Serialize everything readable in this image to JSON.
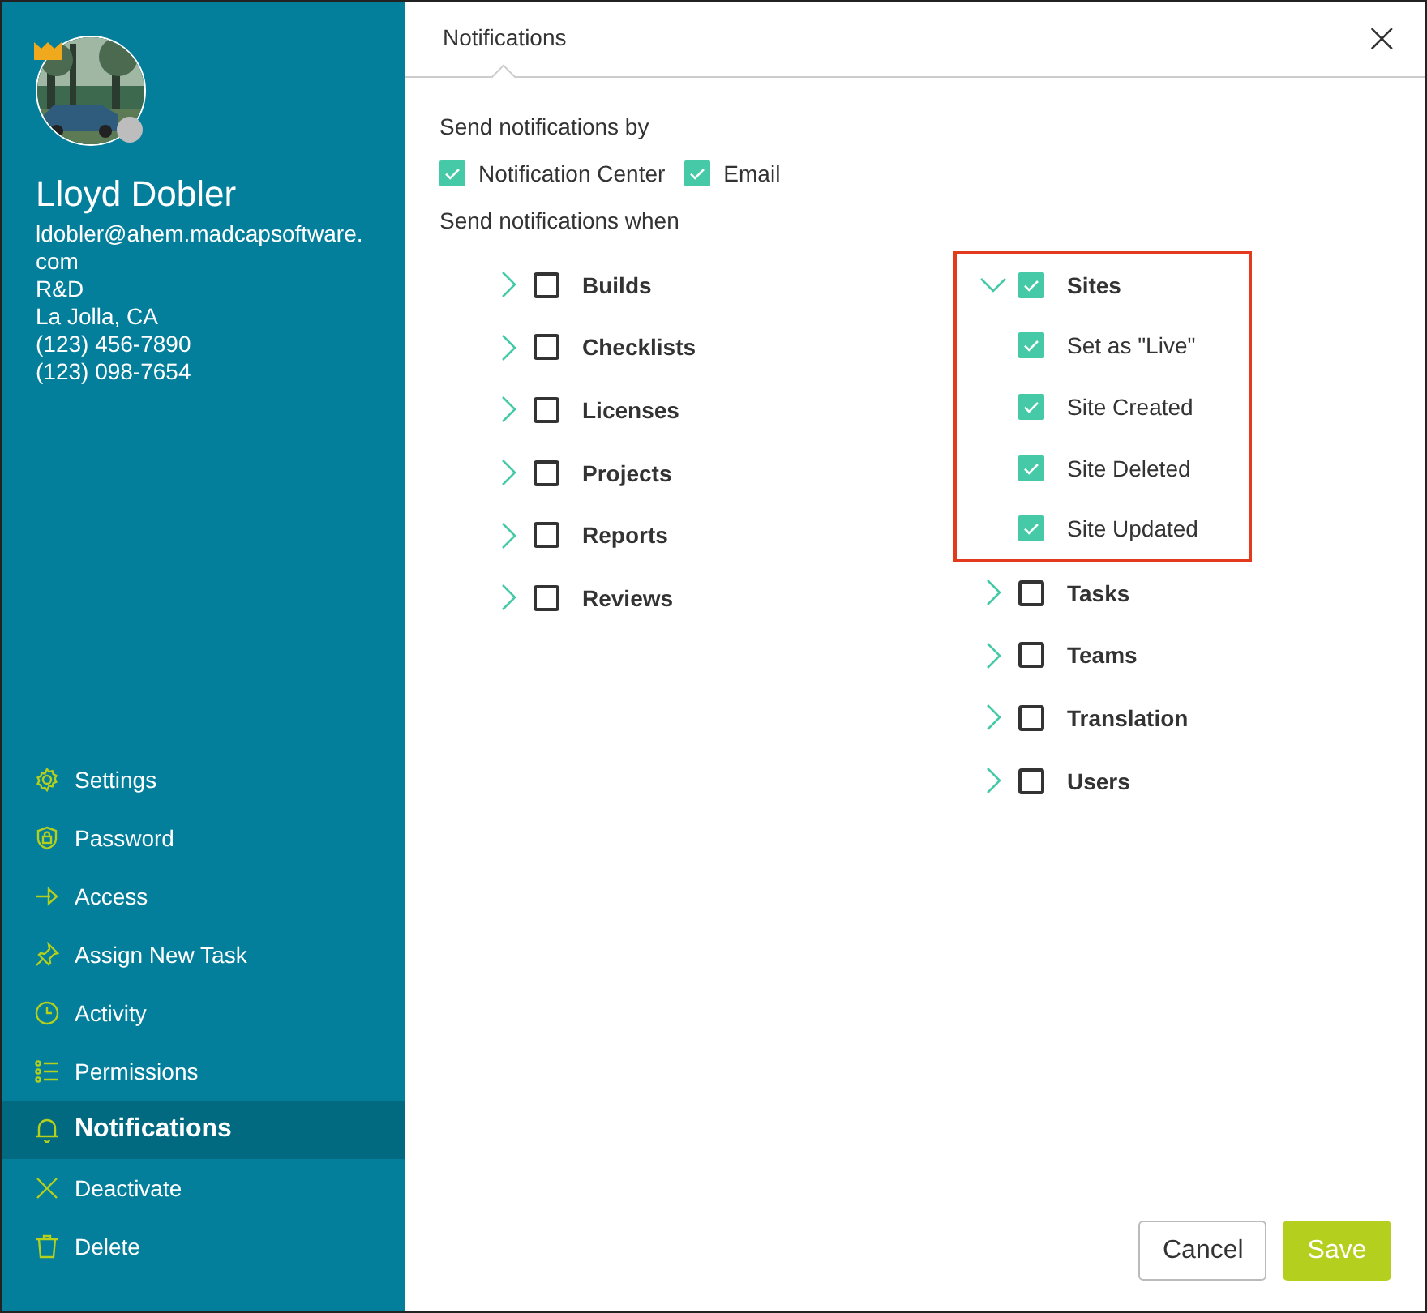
{
  "profile": {
    "name": "Lloyd Dobler",
    "crown": true,
    "online": false,
    "details": [
      "ldobler@ahem.madcapsoftware.com",
      "R&D",
      "La Jolla, CA",
      "(123) 456-7890",
      "(123) 098-7654"
    ]
  },
  "menu": [
    {
      "kind": "settings",
      "label": "Settings",
      "selected": false
    },
    {
      "kind": "password",
      "label": "Password",
      "selected": false
    },
    {
      "kind": "access",
      "label": "Access",
      "selected": false
    },
    {
      "kind": "assign",
      "label": "Assign New Task",
      "selected": false
    },
    {
      "kind": "activity",
      "label": "Activity",
      "selected": false
    },
    {
      "kind": "permissions",
      "label": "Permissions",
      "selected": false
    },
    {
      "kind": "notifications",
      "label": "Notifications",
      "selected": true
    },
    {
      "kind": "deactivate",
      "label": "Deactivate",
      "selected": false
    },
    {
      "kind": "delete",
      "label": "Delete",
      "selected": false
    }
  ],
  "dialog": {
    "title": "Notifications",
    "close": "×"
  },
  "send_by_label": "Send notifications by",
  "channels": [
    {
      "label": "Notification Center",
      "checked": true
    },
    {
      "label": "Email",
      "checked": true
    }
  ],
  "send_when_label": "Send notifications when",
  "columns": [
    [
      {
        "label": "Builds",
        "checked": false,
        "expanded": false,
        "highlighted": false
      },
      {
        "label": "Checklists",
        "checked": false,
        "expanded": false,
        "highlighted": false
      },
      {
        "label": "Licenses",
        "checked": false,
        "expanded": false,
        "highlighted": false
      },
      {
        "label": "Projects",
        "checked": false,
        "expanded": false,
        "highlighted": false
      },
      {
        "label": "Reports",
        "checked": false,
        "expanded": false,
        "highlighted": false
      },
      {
        "label": "Reviews",
        "checked": false,
        "expanded": false,
        "highlighted": false
      }
    ],
    [
      {
        "label": "Sites",
        "checked": true,
        "expanded": true,
        "highlighted": true,
        "children": [
          {
            "label": "Set as \"Live\"",
            "checked": true
          },
          {
            "label": "Site Created",
            "checked": true
          },
          {
            "label": "Site Deleted",
            "checked": true
          },
          {
            "label": "Site Updated",
            "checked": true
          }
        ]
      },
      {
        "label": "Tasks",
        "checked": false,
        "expanded": false,
        "highlighted": false
      },
      {
        "label": "Teams",
        "checked": false,
        "expanded": false,
        "highlighted": false
      },
      {
        "label": "Translation",
        "checked": false,
        "expanded": false,
        "highlighted": false
      },
      {
        "label": "Users",
        "checked": false,
        "expanded": false,
        "highlighted": false
      }
    ]
  ],
  "buttons": [
    {
      "kind": "secondary",
      "label": "Cancel"
    },
    {
      "kind": "primary",
      "label": "Save"
    }
  ]
}
